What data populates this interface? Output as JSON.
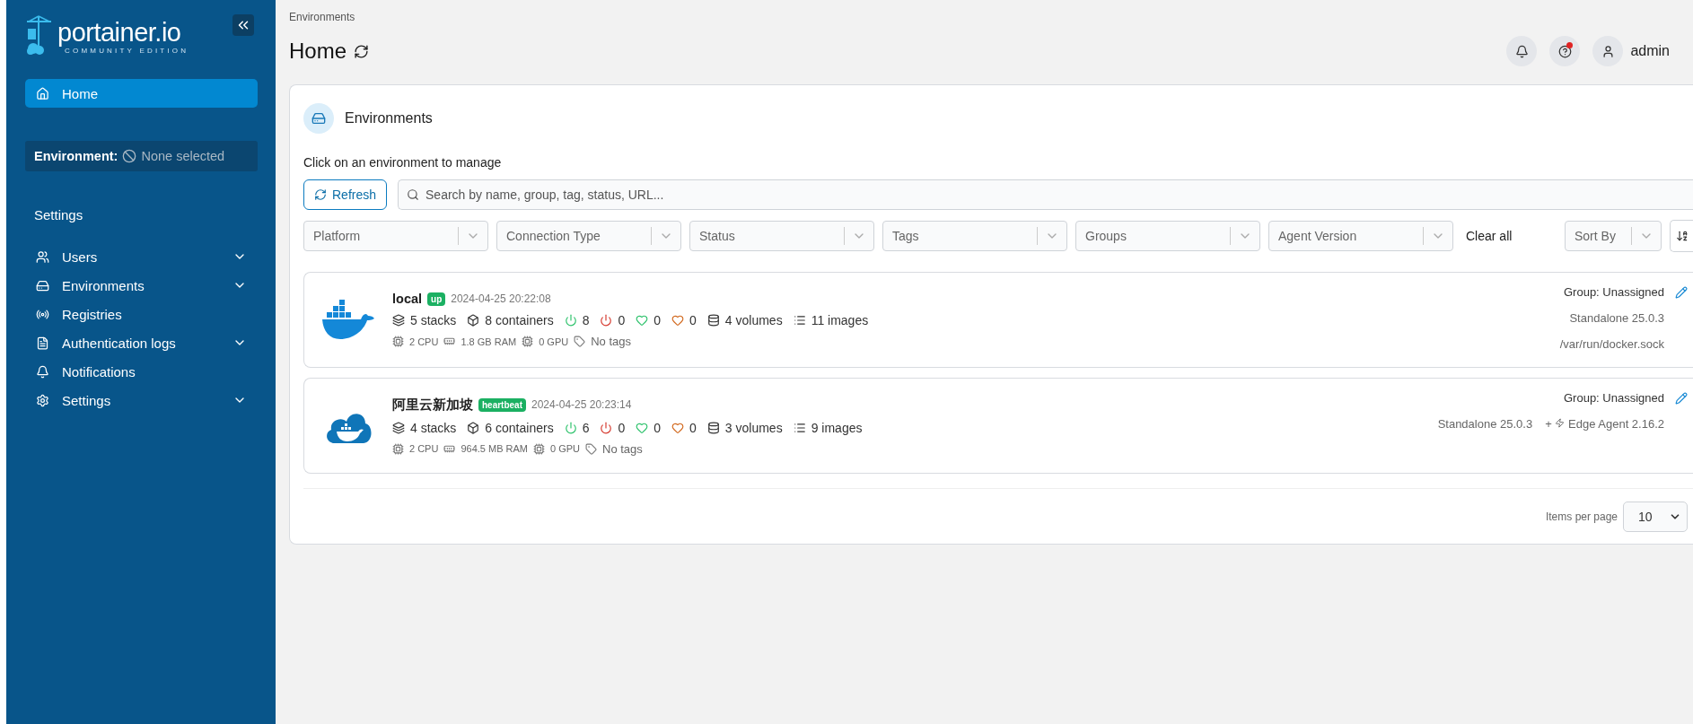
{
  "sidebar": {
    "logo": {
      "name": "portainer.io",
      "subtitle": "COMMUNITY EDITION"
    },
    "home": {
      "label": "Home",
      "selected": true
    },
    "environment": {
      "label": "Environment:",
      "value": "None selected"
    },
    "section_title": "Settings",
    "items": [
      {
        "label": "Users",
        "has_submenu": true,
        "selected": false
      },
      {
        "label": "Environments",
        "has_submenu": true,
        "selected": false
      },
      {
        "label": "Registries",
        "has_submenu": false,
        "selected": false
      },
      {
        "label": "Authentication logs",
        "has_submenu": true,
        "selected": false
      },
      {
        "label": "Notifications",
        "has_submenu": false,
        "selected": false
      },
      {
        "label": "Settings",
        "has_submenu": true,
        "selected": false
      }
    ]
  },
  "header": {
    "breadcrumb": "Environments",
    "title": "Home",
    "user": "admin"
  },
  "panel": {
    "title": "Environments",
    "hint": "Click on an environment to manage",
    "refresh": "Refresh",
    "search": {
      "placeholder": "Search by name, group, tag, status, URL..."
    },
    "filters": [
      "Platform",
      "Connection Type",
      "Status",
      "Tags",
      "Groups",
      "Agent Version"
    ],
    "clear_all": "Clear all",
    "sort": {
      "placeholder": "Sort By"
    },
    "environments": [
      {
        "kind": "docker",
        "name": "local",
        "status": "up",
        "time": "2024-04-25 20:22:08",
        "stacks": "5 stacks",
        "containers": "8 containers",
        "running": "8",
        "stopped": "0",
        "healthy": "0",
        "unhealthy": "0",
        "volumes": "4 volumes",
        "images": "11 images",
        "cpu": "2 CPU",
        "ram": "1.8 GB RAM",
        "gpu": "0 GPU",
        "tags": "No tags",
        "group": "Group: Unassigned",
        "details": [
          "Standalone 25.0.3",
          "/var/run/docker.sock"
        ]
      },
      {
        "kind": "edge",
        "name": "阿里云新加坡",
        "status": "heartbeat",
        "time": "2024-04-25 20:23:14",
        "stacks": "4 stacks",
        "containers": "6 containers",
        "running": "6",
        "stopped": "0",
        "healthy": "0",
        "unhealthy": "0",
        "volumes": "3 volumes",
        "images": "9 images",
        "cpu": "2 CPU",
        "ram": "964.5 MB RAM",
        "gpu": "0 GPU",
        "tags": "No tags",
        "group": "Group: Unassigned",
        "details": [
          "Standalone 25.0.3"
        ],
        "edge_agent": {
          "prefix": "+",
          "label": "Edge Agent 2.16.2"
        }
      }
    ],
    "pagination": {
      "label": "Items per page",
      "value": "10"
    }
  }
}
